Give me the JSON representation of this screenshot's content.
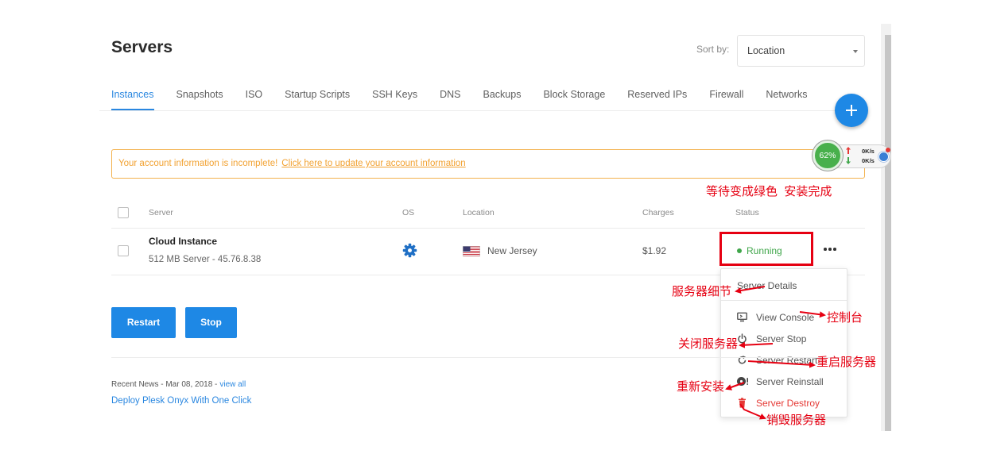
{
  "page": {
    "title": "Servers"
  },
  "sort": {
    "label": "Sort by:",
    "selected": "Location",
    "caret_icon": "caret-down-icon"
  },
  "tabs": [
    {
      "label": "Instances",
      "active": true
    },
    {
      "label": "Snapshots"
    },
    {
      "label": "ISO"
    },
    {
      "label": "Startup Scripts"
    },
    {
      "label": "SSH Keys"
    },
    {
      "label": "DNS"
    },
    {
      "label": "Backups"
    },
    {
      "label": "Block Storage"
    },
    {
      "label": "Reserved IPs"
    },
    {
      "label": "Firewall"
    },
    {
      "label": "Networks"
    }
  ],
  "fab": {
    "icon": "plus-icon"
  },
  "alert": {
    "message": "Your account information is incomplete!",
    "link": "Click here to update your account information"
  },
  "net_monitor": {
    "percent": "62%",
    "upload": "0K/s",
    "download": "0K/s",
    "upload_icon": "arrow-up-icon",
    "download_icon": "arrow-down-icon"
  },
  "table": {
    "headers": {
      "server": "Server",
      "os": "OS",
      "location": "Location",
      "charges": "Charges",
      "status": "Status"
    },
    "rows": [
      {
        "name": "Cloud Instance",
        "detail": "512 MB Server - 45.76.8.38",
        "os_icon": "os-logo-icon",
        "flag_icon": "us-flag-icon",
        "location": "New Jersey",
        "charges": "$1.92",
        "status": "Running",
        "more_icon": "more-horizontal-icon"
      }
    ]
  },
  "row_menu": {
    "items": [
      {
        "label": "Server Details"
      },
      {
        "label": "View Console",
        "icon": "monitor-icon"
      },
      {
        "label": "Server Stop",
        "icon": "power-icon"
      },
      {
        "label": "Server Restart",
        "icon": "restart-icon"
      },
      {
        "label": "Server Reinstall",
        "icon": "reinstall-disc-icon"
      },
      {
        "label": "Server Destroy",
        "icon": "trash-icon",
        "danger": true
      }
    ]
  },
  "actions": {
    "restart": "Restart",
    "stop": "Stop"
  },
  "news": {
    "prefix": "Recent News - Mar 08, 2018 -",
    "view_all": "view all",
    "headline": "Deploy Plesk Onyx With One Click"
  },
  "annotations": {
    "status_note": "等待变成绿色  安装完成",
    "details": "服务器细节",
    "console": "控制台",
    "stop": "关闭服务器",
    "restart": "重启服务器",
    "reinstall": "重新安装",
    "destroy": "销毁服务器"
  },
  "colors": {
    "primary": "#1e88e5",
    "link": "#2a87e0",
    "alert": "#f2a232",
    "running": "#3fa64a",
    "danger": "#e53935",
    "annotation": "#e60012"
  }
}
